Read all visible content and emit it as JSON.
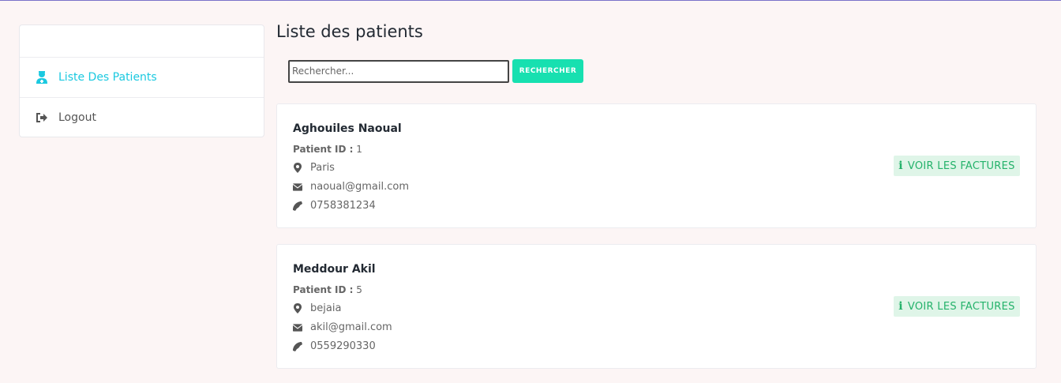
{
  "sidebar": {
    "items": [
      {
        "label": "Liste Des Patients",
        "icon": "user-nurse-icon",
        "active": true
      },
      {
        "label": "Logout",
        "icon": "sign-out-icon",
        "active": false
      }
    ]
  },
  "main": {
    "title": "Liste des patients",
    "search": {
      "placeholder": "Rechercher...",
      "button": "RECHERCHER"
    }
  },
  "patients": [
    {
      "name": "Aghouiles Naoual",
      "id_label": "Patient ID :",
      "id": "1",
      "city": "Paris",
      "email": "naoual@gmail.com",
      "phone": "0758381234",
      "action": "VOIR LES FACTURES"
    },
    {
      "name": "Meddour Akil",
      "id_label": "Patient ID :",
      "id": "5",
      "city": "bejaia",
      "email": "akil@gmail.com",
      "phone": "0559290330",
      "action": "VOIR LES FACTURES"
    }
  ],
  "colors": {
    "accent": "#1bc9e0",
    "search_button": "#17e0b0",
    "factures_text": "#24b26a",
    "factures_bg": "#dff5e8"
  }
}
